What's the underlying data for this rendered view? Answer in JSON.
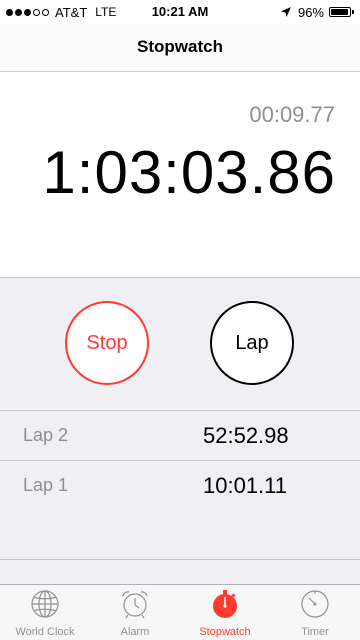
{
  "status": {
    "carrier": "AT&T",
    "network": "LTE",
    "time": "10:21 AM",
    "battery": "96%",
    "battery_level": 0.96,
    "signal_bars": 3,
    "signal_total": 5
  },
  "nav": {
    "title": "Stopwatch"
  },
  "timer": {
    "lap_time": "00:09.77",
    "main_time": "1:03:03.86"
  },
  "controls": {
    "stop_label": "Stop",
    "lap_label": "Lap"
  },
  "laps": [
    {
      "label": "Lap 2",
      "time": "52:52.98"
    },
    {
      "label": "Lap 1",
      "time": "10:01.11"
    }
  ],
  "tabs": [
    {
      "label": "World Clock",
      "icon": "globe-icon",
      "active": false
    },
    {
      "label": "Alarm",
      "icon": "alarm-clock-icon",
      "active": false
    },
    {
      "label": "Stopwatch",
      "icon": "stopwatch-icon",
      "active": true
    },
    {
      "label": "Timer",
      "icon": "timer-icon",
      "active": false
    }
  ],
  "colors": {
    "accent": "#ff3b30",
    "inactive": "#929292",
    "background": "#efeff4"
  }
}
